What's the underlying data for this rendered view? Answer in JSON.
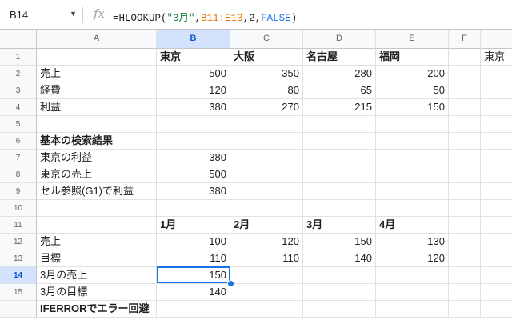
{
  "name_box": "B14",
  "fx_label": "fx",
  "formula": {
    "p1": "=HLOOKUP(",
    "p2": "\"3月\"",
    "p3": ",",
    "p4": "B11:E13",
    "p5": ",2,",
    "p6": "FALSE",
    "p7": ")"
  },
  "colors": {
    "selection": "#1a73e8",
    "header_selected": "#d3e3fd",
    "string": "#188038",
    "range": "#e37400",
    "bool": "#1a73e8"
  },
  "columns": [
    "A",
    "B",
    "C",
    "D",
    "E",
    "F"
  ],
  "rows": [
    "1",
    "2",
    "3",
    "4",
    "5",
    "6",
    "7",
    "8",
    "9",
    "10",
    "11",
    "12",
    "13",
    "14",
    "15",
    ""
  ],
  "cells": {
    "B1": "東京",
    "C1": "大阪",
    "D1": "名古屋",
    "E1": "福岡",
    "G1": "東京",
    "A2": "売上",
    "B2": "500",
    "C2": "350",
    "D2": "280",
    "E2": "200",
    "A3": "経費",
    "B3": "120",
    "C3": "80",
    "D3": "65",
    "E3": "50",
    "A4": "利益",
    "B4": "380",
    "C4": "270",
    "D4": "215",
    "E4": "150",
    "A6": "基本の検索結果",
    "A7": "東京の利益",
    "B7": "380",
    "A8": "東京の売上",
    "B8": "500",
    "A9": "セル参照(G1)で利益",
    "B9": "380",
    "B11": "1月",
    "C11": "2月",
    "D11": "3月",
    "E11": "4月",
    "A12": "売上",
    "B12": "100",
    "C12": "120",
    "D12": "150",
    "E12": "130",
    "A13": "目標",
    "B13": "110",
    "C13": "110",
    "D13": "140",
    "E13": "120",
    "A14": "3月の売上",
    "B14": "150",
    "A15": "3月の目標",
    "B15": "140",
    "A16": "IFERRORでエラー回避"
  }
}
